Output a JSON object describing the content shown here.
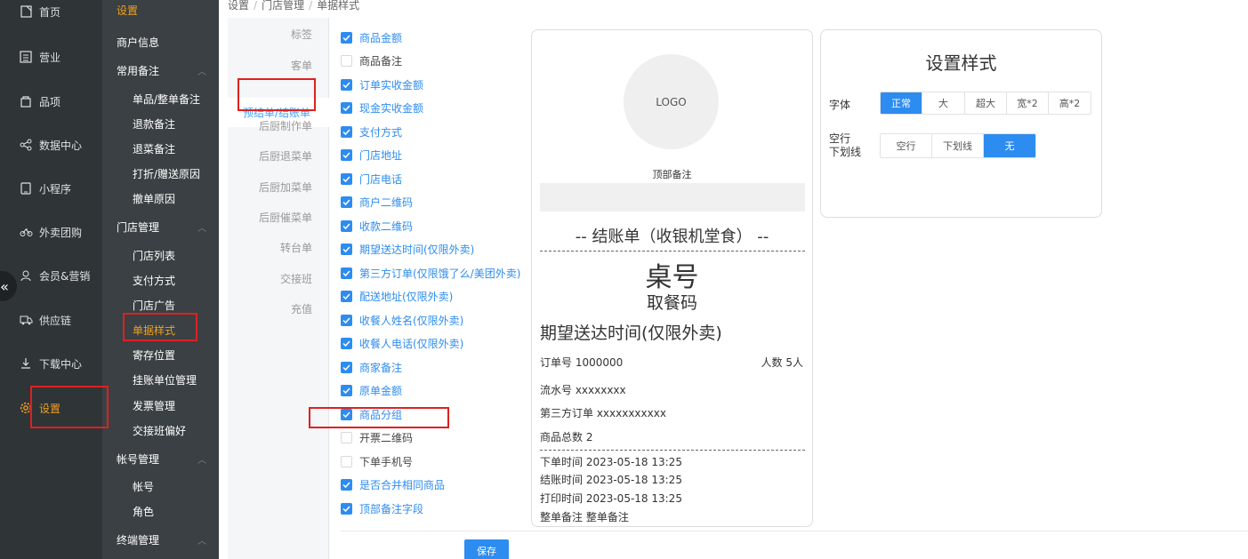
{
  "main_nav": [
    {
      "label": "首页",
      "icon": "doc-icon",
      "active": false
    },
    {
      "label": "营业",
      "icon": "grid-icon",
      "active": false
    },
    {
      "label": "品项",
      "icon": "bag-icon",
      "active": false
    },
    {
      "label": "数据中心",
      "icon": "share-icon",
      "active": false
    },
    {
      "label": "小程序",
      "icon": "phone-icon",
      "active": false
    },
    {
      "label": "外卖团购",
      "icon": "bike-icon",
      "active": false
    },
    {
      "label": "会员&营销",
      "icon": "user-icon",
      "active": false
    },
    {
      "label": "供应链",
      "icon": "truck-icon",
      "active": false
    },
    {
      "label": "下载中心",
      "icon": "download-icon",
      "active": false
    },
    {
      "label": "设置",
      "icon": "gear-icon",
      "active": true
    }
  ],
  "collapse_glyph": "«",
  "sub_nav": {
    "title": "设置",
    "merchant_info": "商户信息",
    "common_notes": "常用备注",
    "common_notes_items": [
      "单品/整单备注",
      "退款备注",
      "退菜备注",
      "打折/赠送原因",
      "撤单原因"
    ],
    "store_mgmt": "门店管理",
    "store_items": [
      "门店列表",
      "支付方式",
      "门店广告",
      "单据样式",
      "寄存位置",
      "挂账单位管理",
      "发票管理",
      "交接班偏好"
    ],
    "account_mgmt": "帐号管理",
    "account_items": [
      "帐号",
      "角色"
    ],
    "terminal_mgmt": "终端管理"
  },
  "breadcrumb": [
    "设置",
    "门店管理",
    "单据样式"
  ],
  "receipt_tabs": [
    "标签",
    "客单",
    "预结单/结账单",
    "后厨制作单",
    "后厨退菜单",
    "后厨加菜单",
    "后厨催菜单",
    "转台单",
    "交接班",
    "充值"
  ],
  "fields": [
    {
      "label": "商品金额",
      "checked": true
    },
    {
      "label": "商品备注",
      "checked": false
    },
    {
      "label": "订单实收金额",
      "checked": true
    },
    {
      "label": "现金实收金额",
      "checked": true
    },
    {
      "label": "支付方式",
      "checked": true
    },
    {
      "label": "门店地址",
      "checked": true
    },
    {
      "label": "门店电话",
      "checked": true
    },
    {
      "label": "商户二维码",
      "checked": true
    },
    {
      "label": "收款二维码",
      "checked": true
    },
    {
      "label": "期望送达时间(仅限外卖)",
      "checked": true
    },
    {
      "label": "第三方订单(仅限饿了么/美团外卖)",
      "checked": true
    },
    {
      "label": "配送地址(仅限外卖)",
      "checked": true
    },
    {
      "label": "收餐人姓名(仅限外卖)",
      "checked": true
    },
    {
      "label": "收餐人电话(仅限外卖)",
      "checked": true
    },
    {
      "label": "商家备注",
      "checked": true
    },
    {
      "label": "原单金额",
      "checked": true
    },
    {
      "label": "商品分组",
      "checked": true
    },
    {
      "label": "开票二维码",
      "checked": false
    },
    {
      "label": "下单手机号",
      "checked": false
    },
    {
      "label": "是否合并相同商品",
      "checked": true
    },
    {
      "label": "顶部备注字段",
      "checked": true
    }
  ],
  "receipt": {
    "logo": "LOGO",
    "top_note": "顶部备注",
    "title": "-- 结账单（收银机堂食） --",
    "table_no": "桌号",
    "pickup_code": "取餐码",
    "expected_time": "期望送达时间(仅限外卖)",
    "order_no": "订单号 1000000",
    "guests": "人数 5人",
    "serial": "流水号 xxxxxxxx",
    "third_party": "第三方订单 xxxxxxxxxxx",
    "item_count": "商品总数 2",
    "order_time": "下单时间 2023-05-18 13:25",
    "checkout_time": "结账时间 2023-05-18 13:25",
    "print_time": "打印时间 2023-05-18 13:25",
    "order_note": "整单备注 整单备注"
  },
  "style_panel": {
    "title": "设置样式",
    "font_label": "字体",
    "font_options": [
      "正常",
      "大",
      "超大",
      "宽*2",
      "高*2"
    ],
    "font_selected": "正常",
    "blank_label": "空行\n下划线",
    "blank_options": [
      "空行",
      "下划线",
      "无"
    ],
    "blank_selected": "无"
  },
  "save_label": "保存",
  "colors": {
    "accent": "#2d8cf0",
    "nav_active": "#f0a020",
    "highlight": "#e02020"
  }
}
